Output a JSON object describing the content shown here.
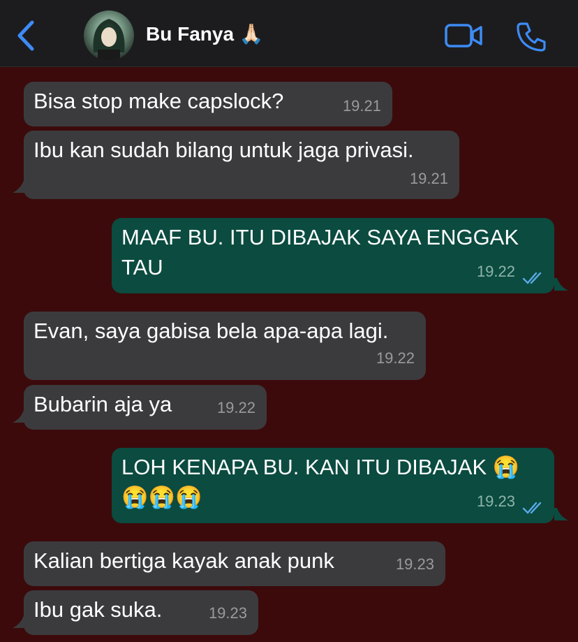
{
  "header": {
    "contact_name": "Bu Fanya 🙏🏻",
    "back_icon": "chevron-left-icon",
    "video_icon": "video-camera-icon",
    "call_icon": "phone-icon",
    "accent_color": "#3d8bf5"
  },
  "messages": [
    {
      "direction": "in",
      "text": "Bisa stop make capslock?",
      "time": "19.21"
    },
    {
      "direction": "in",
      "text": "Ibu kan sudah bilang untuk jaga privasi.",
      "time": "19.21"
    },
    {
      "direction": "out",
      "text": "MAAF BU. ITU DIBAJAK SAYA ENGGAK TAU",
      "time": "19.22",
      "status": "read"
    },
    {
      "direction": "in",
      "text": "Evan, saya gabisa bela apa-apa lagi.",
      "time": "19.22"
    },
    {
      "direction": "in",
      "text": "Bubarin aja ya",
      "time": "19.22"
    },
    {
      "direction": "out",
      "text": "LOH KENAPA BU. KAN ITU DIBAJAK 😭😭😭😭",
      "time": "19.23",
      "status": "read"
    },
    {
      "direction": "in",
      "text": "Kalian bertiga kayak anak punk",
      "time": "19.23"
    },
    {
      "direction": "in",
      "text": "Ibu gak suka.",
      "time": "19.23"
    }
  ],
  "colors": {
    "background": "#3c0a0b",
    "incoming_bubble": "#3b3b3e",
    "outgoing_bubble": "#0b4b40",
    "read_ticks": "#5aa9e6"
  }
}
